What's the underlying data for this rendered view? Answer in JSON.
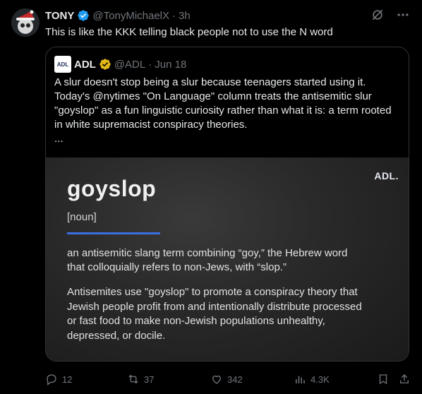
{
  "tweet": {
    "author_name": "TONY",
    "handle": "@TonyMichaelX",
    "separator": "·",
    "time": "3h",
    "text": "This is like the KKK telling black people not to use the N word"
  },
  "quote": {
    "logo_text": "ADL",
    "author_name": "ADL",
    "handle": "@ADL",
    "separator": "·",
    "time": "Jun 18",
    "text": "A slur doesn't stop being a slur because teenagers started using it. Today's @nytimes \"On Language\" column treats the antisemitic slur \"goyslop\" as a fun linguistic curiosity rather than what it is: a term rooted in white supremacist conspiracy theories.",
    "ellipsis": "...",
    "card": {
      "brand": "ADL.",
      "word": "goyslop",
      "part_of_speech": "[noun]",
      "definition": "an antisemitic slang term combining “goy,” the Hebrew word that colloquially refers to non-Jews, with “slop.”",
      "description": "Antisemites use \"goyslop\" to promote a conspiracy theory that Jewish people profit from and intentionally distribute processed or fast food to make non-Jewish populations unhealthy, depressed, or docile."
    }
  },
  "actions": {
    "replies": "12",
    "reposts": "37",
    "likes": "342",
    "views": "4.3K"
  },
  "icons": {
    "verified_blue": "#1d9bf0",
    "verified_gold": "#e2b719",
    "accent_rule": "#3b6fe0"
  }
}
